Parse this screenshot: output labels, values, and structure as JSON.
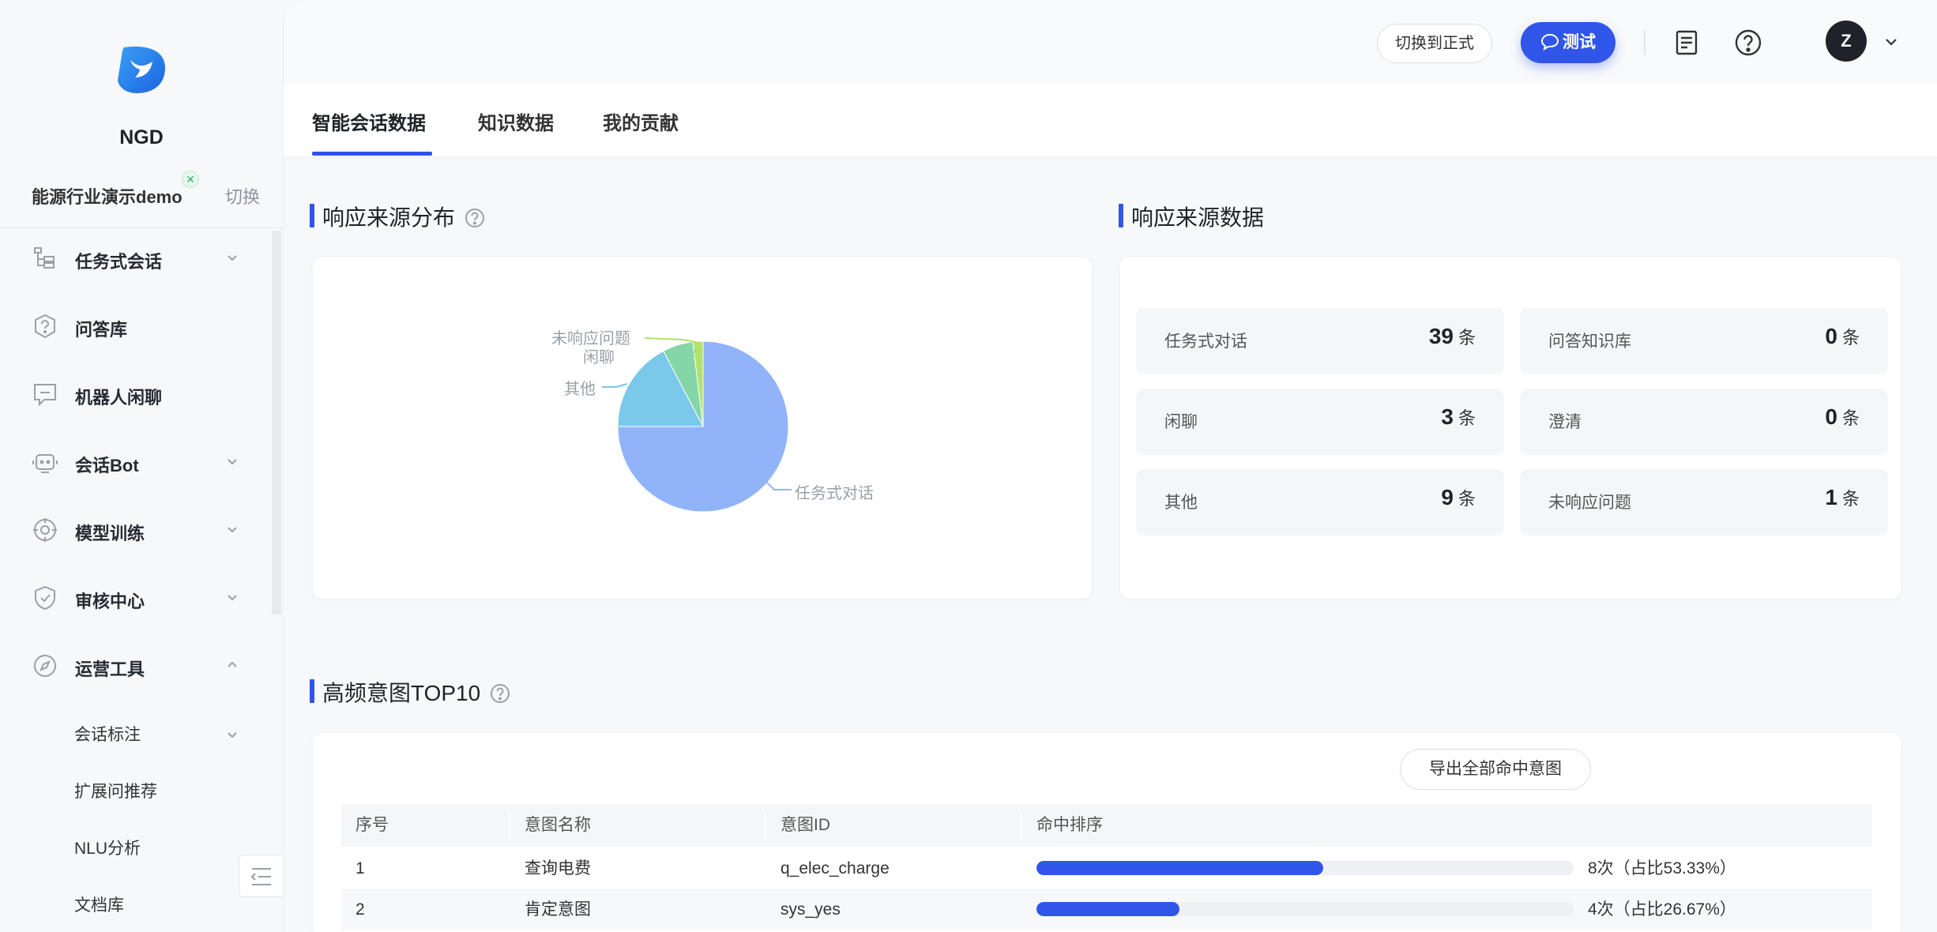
{
  "sidebar": {
    "brand": "NGD",
    "tenant": {
      "name": "能源行业演示demo",
      "badge": "✕",
      "switch_label": "切换"
    },
    "menu": [
      {
        "label": "任务式会话",
        "icon": "task-flow-icon",
        "expandable": true,
        "expanded": false
      },
      {
        "label": "问答库",
        "icon": "question-shield-icon",
        "expandable": false
      },
      {
        "label": "机器人闲聊",
        "icon": "chat-bubble-icon",
        "expandable": false
      },
      {
        "label": "会话Bot",
        "icon": "robot-icon",
        "expandable": true,
        "expanded": false
      },
      {
        "label": "模型训练",
        "icon": "target-icon",
        "expandable": true,
        "expanded": false
      },
      {
        "label": "审核中心",
        "icon": "check-shield-icon",
        "expandable": true,
        "expanded": false
      },
      {
        "label": "运营工具",
        "icon": "compass-icon",
        "expandable": true,
        "expanded": true
      }
    ],
    "submenu": [
      {
        "label": "会话标注",
        "expandable": true
      },
      {
        "label": "扩展问推荐",
        "expandable": false
      },
      {
        "label": "NLU分析",
        "expandable": false
      },
      {
        "label": "文档库",
        "expandable": false
      }
    ]
  },
  "topbar": {
    "switch_label": "切换到正式",
    "test_label": "测试",
    "avatar_initial": "Z"
  },
  "tabs": [
    {
      "label": "智能会话数据",
      "active": true
    },
    {
      "label": "知识数据",
      "active": false
    },
    {
      "label": "我的贡献",
      "active": false
    }
  ],
  "distribution": {
    "title": "响应来源分布",
    "chart_data": {
      "type": "pie",
      "slices": [
        {
          "name": "任务式对话",
          "value": 39,
          "color": "#91b4f8"
        },
        {
          "name": "其他",
          "value": 9,
          "color": "#7ac8ea"
        },
        {
          "name": "闲聊",
          "value": 3,
          "color": "#84d5a8"
        },
        {
          "name": "未响应问题",
          "value": 1,
          "color": "#b3e26a"
        },
        {
          "name": "问答知识库",
          "value": 0,
          "color": "#f5c85b"
        },
        {
          "name": "澄清",
          "value": 0,
          "color": "#f09a7a"
        }
      ],
      "labels_shown": [
        "未响应问题",
        "闲聊",
        "其他",
        "任务式对话"
      ]
    }
  },
  "source_data": {
    "title": "响应来源数据",
    "unit": "条",
    "stats": [
      {
        "label": "任务式对话",
        "value": "39"
      },
      {
        "label": "问答知识库",
        "value": "0"
      },
      {
        "label": "闲聊",
        "value": "3"
      },
      {
        "label": "澄清",
        "value": "0"
      },
      {
        "label": "其他",
        "value": "9"
      },
      {
        "label": "未响应问题",
        "value": "1"
      }
    ]
  },
  "top_intents": {
    "title": "高频意图TOP10",
    "export_label": "导出全部命中意图",
    "columns": [
      "序号",
      "意图名称",
      "意图ID",
      "命中排序"
    ],
    "rows": [
      {
        "index": "1",
        "name": "查询电费",
        "id": "q_elec_charge",
        "hits": "8次（占比53.33%）",
        "ratio": 0.5333
      },
      {
        "index": "2",
        "name": "肯定意图",
        "id": "sys_yes",
        "hits": "4次（占比26.67%）",
        "ratio": 0.2667
      }
    ]
  }
}
